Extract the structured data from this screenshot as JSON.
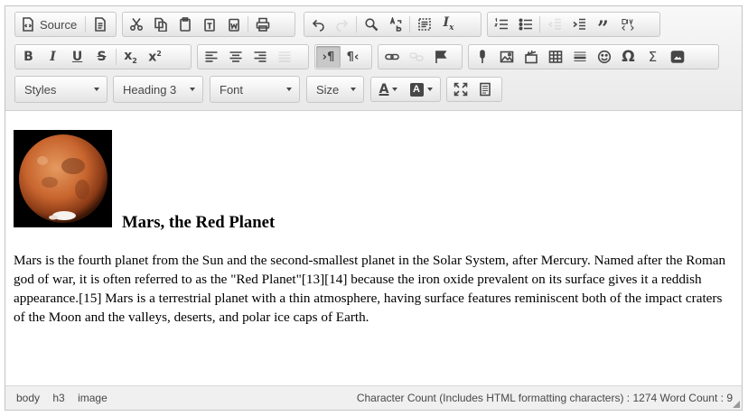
{
  "toolbar": {
    "source_label": "Source",
    "styles_label": "Styles",
    "format_label": "Heading 3",
    "font_label": "Font",
    "size_label": "Size"
  },
  "content": {
    "title": "Mars, the Red Planet",
    "paragraph": "Mars is the fourth planet from the Sun and the second-smallest planet in the Solar System, after Mercury. Named after the Roman god of war, it is often referred to as the \"Red Planet\"[13][14] because the iron oxide prevalent on its surface gives it a reddish appearance.[15] Mars is a terrestrial planet with a thin atmosphere, having surface features reminiscent both of the impact craters of the Moon and the valleys, deserts, and polar ice caps of Earth."
  },
  "status": {
    "path": [
      "body",
      "h3",
      "image"
    ],
    "counts": "Character Count (Includes HTML formatting characters) : 1274 Word Count : 9"
  },
  "colors": {
    "text": "#474747",
    "mars": "#c8652e",
    "border": "#c4c4c4"
  }
}
